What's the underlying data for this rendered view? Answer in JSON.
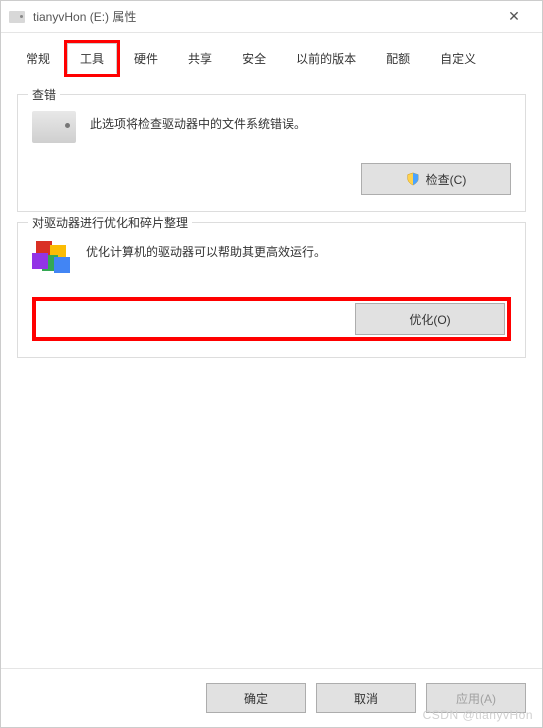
{
  "window": {
    "title": "tianyvHon (E:) 属性"
  },
  "tabs": [
    {
      "label": "常规"
    },
    {
      "label": "工具"
    },
    {
      "label": "硬件"
    },
    {
      "label": "共享"
    },
    {
      "label": "安全"
    },
    {
      "label": "以前的版本"
    },
    {
      "label": "配额"
    },
    {
      "label": "自定义"
    }
  ],
  "group_check": {
    "title": "查错",
    "desc": "此选项将检查驱动器中的文件系统错误。",
    "button": "检查(C)"
  },
  "group_optimize": {
    "title": "对驱动器进行优化和碎片整理",
    "desc": "优化计算机的驱动器可以帮助其更高效运行。",
    "button": "优化(O)"
  },
  "footer": {
    "ok": "确定",
    "cancel": "取消",
    "apply": "应用(A)"
  },
  "watermark": "CSDN @tianyvHon"
}
